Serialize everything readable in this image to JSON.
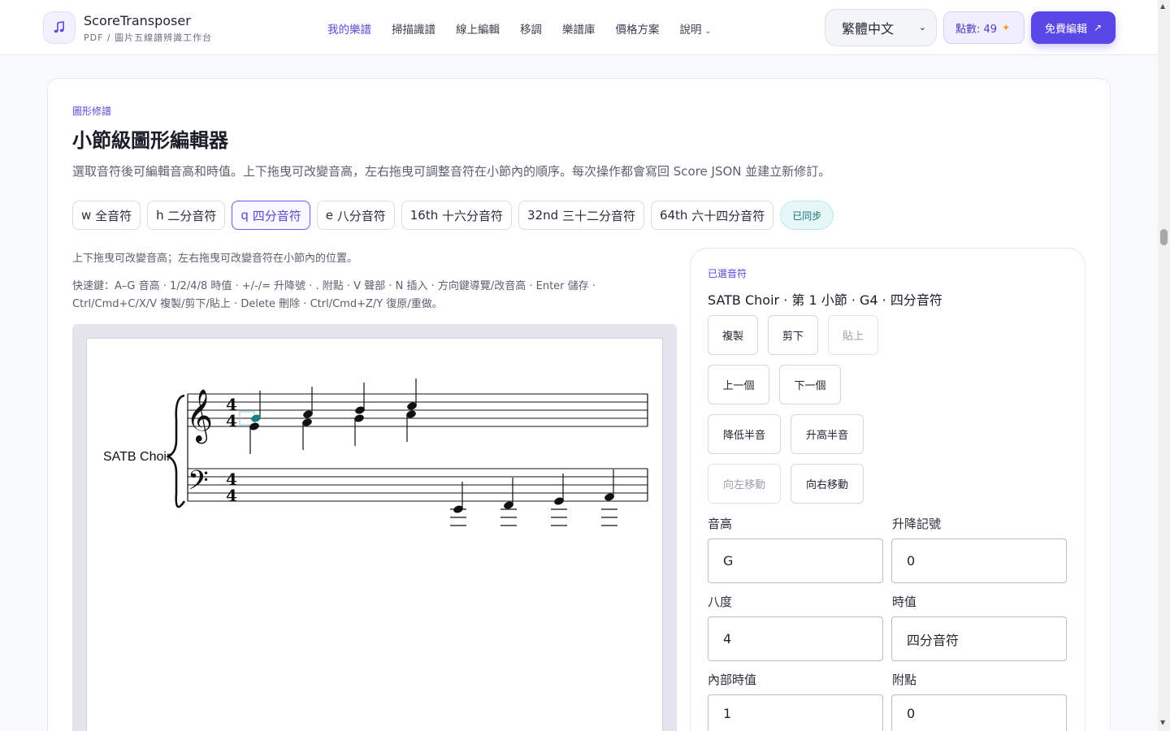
{
  "brand": {
    "name": "ScoreTransposer",
    "subtitle": "PDF / 圖片五線譜辨識工作台"
  },
  "nav": {
    "items": [
      "我的樂譜",
      "掃描識譜",
      "線上編輯",
      "移調",
      "樂譜庫",
      "價格方案",
      "說明"
    ],
    "active_index": 0
  },
  "header": {
    "language": "繁體中文",
    "points": "點數: 49",
    "cta": "免費編輯"
  },
  "editor": {
    "eyebrow": "圖形修譜",
    "title": "小節級圖形編輯器",
    "description": "選取音符後可編輯音高和時值。上下拖曳可改變音高，左右拖曳可調整音符在小節內的順序。每次操作都會寫回 Score JSON 並建立新修訂。",
    "durations": [
      {
        "key": "w",
        "label": "全音符"
      },
      {
        "key": "h",
        "label": "二分音符"
      },
      {
        "key": "q",
        "label": "四分音符"
      },
      {
        "key": "e",
        "label": "八分音符"
      },
      {
        "key": "16th",
        "label": "十六分音符"
      },
      {
        "key": "32nd",
        "label": "三十二分音符"
      },
      {
        "key": "64th",
        "label": "六十四分音符"
      }
    ],
    "active_duration": 2,
    "sync_status": "已同步",
    "hint_drag": "上下拖曳可改變音高；左右拖曳可改變音符在小節內的位置。",
    "hint_shortcuts": "快速鍵：A–G 音高 · 1/2/4/8 時值 · +/-/= 升降號 · . 附點 · V 聲部 · N 插入 · 方向鍵導覽/改音高 · Enter 儲存 · Ctrl/Cmd+C/X/V 複製/剪下/貼上 · Delete 刪除 · Ctrl/Cmd+Z/Y 復原/重做。"
  },
  "score": {
    "part_name": "SATB Choir",
    "time_signature": "4/4",
    "treble_notes": [
      "G4 + D4",
      "A4 + E4",
      "B4 + G4",
      "C5 + A4"
    ],
    "bass_notes": [
      "C2",
      "D2",
      "E2",
      "F2"
    ],
    "selected_note": "G4"
  },
  "panel": {
    "eyebrow": "已選音符",
    "title": "SATB Choir · 第 1 小節 · G4 · 四分音符",
    "buttons": {
      "copy": "複製",
      "cut": "剪下",
      "paste": "貼上",
      "prev": "上一個",
      "next": "下一個",
      "lower": "降低半音",
      "raise": "升高半音",
      "move_left": "向左移動",
      "move_right": "向右移動"
    },
    "fields": {
      "pitch_label": "音高",
      "pitch_value": "G",
      "accidental_label": "升降記號",
      "accidental_value": "0",
      "octave_label": "八度",
      "octave_value": "4",
      "duration_label": "時值",
      "duration_value": "四分音符",
      "internal_label": "內部時值",
      "internal_value": "1",
      "dot_label": "附點",
      "dot_value": "0"
    }
  }
}
